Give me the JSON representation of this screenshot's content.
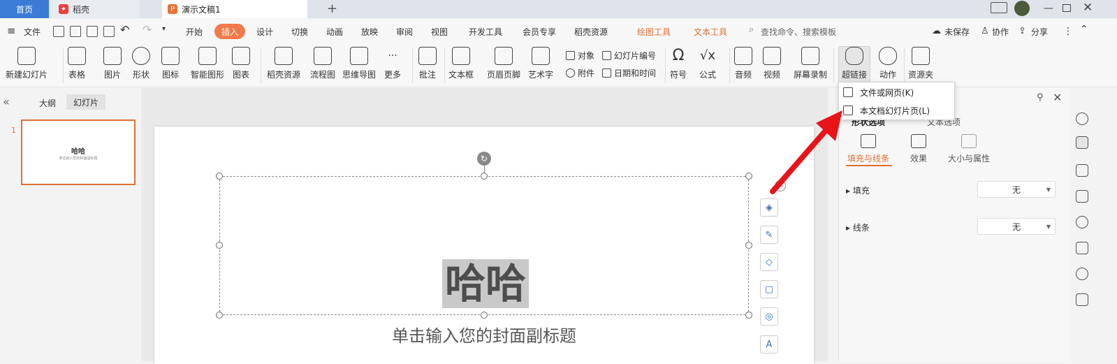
{
  "titlebar": {
    "tabs": [
      {
        "label": "首页"
      },
      {
        "label": "稻壳"
      },
      {
        "label": "演示文稿1"
      }
    ],
    "new_tab": "+"
  },
  "menubar": {
    "file": "文件",
    "items": [
      "开始",
      "插入",
      "设计",
      "切换",
      "动画",
      "放映",
      "审阅",
      "视图",
      "开发工具",
      "会员专享",
      "稻壳资源"
    ],
    "context_tabs": [
      "绘图工具",
      "文本工具"
    ],
    "search_placeholder": "查找命令、搜索模板",
    "unsaved": "未保存",
    "collaborate": "协作",
    "share": "分享"
  },
  "ribbon": {
    "new_slide": "新建幻灯片",
    "table": "表格",
    "picture": "图片",
    "shape": "形状",
    "icon": "图标",
    "smart_graphic": "智能图形",
    "chart": "图表",
    "daoke_resource": "稻壳资源",
    "flowchart": "流程图",
    "mindmap": "思维导图",
    "more": "更多",
    "comment": "批注",
    "textbox": "文本框",
    "header_footer": "页眉页脚",
    "wordart": "艺术字",
    "object": "对象",
    "slide_number": "幻灯片编号",
    "attachment": "附件",
    "datetime": "日期和时间",
    "symbol": "符号",
    "formula": "公式",
    "audio": "音频",
    "video": "视频",
    "screen_record": "屏幕录制",
    "hyperlink": "超链接",
    "action": "动作",
    "resource_folder": "资源夹"
  },
  "leftpanel": {
    "tab_outline": "大纲",
    "tab_slides": "幻灯片",
    "slide_number": "1",
    "thumb_title": "哈哈",
    "thumb_subtitle": "单击输入您的封面副标题"
  },
  "slide": {
    "title": "哈哈",
    "subtitle": "单击输入您的封面副标题"
  },
  "rightpanel": {
    "tab_shape_options": "形状选项",
    "tab_text_options": "文本选项",
    "subtab_fill_line": "填充与线条",
    "subtab_effect": "效果",
    "subtab_size_props": "大小与属性",
    "fill_label": "填充",
    "fill_value": "无",
    "line_label": "线条",
    "line_value": "无"
  },
  "dropdown": {
    "items": [
      {
        "label": "文件或网页(K)"
      },
      {
        "label": "本文档幻灯片页(L)"
      }
    ]
  },
  "colors": {
    "accent": "#e07033",
    "home_tab": "#3a7bd5",
    "annotation_arrow": "#e8141a"
  }
}
